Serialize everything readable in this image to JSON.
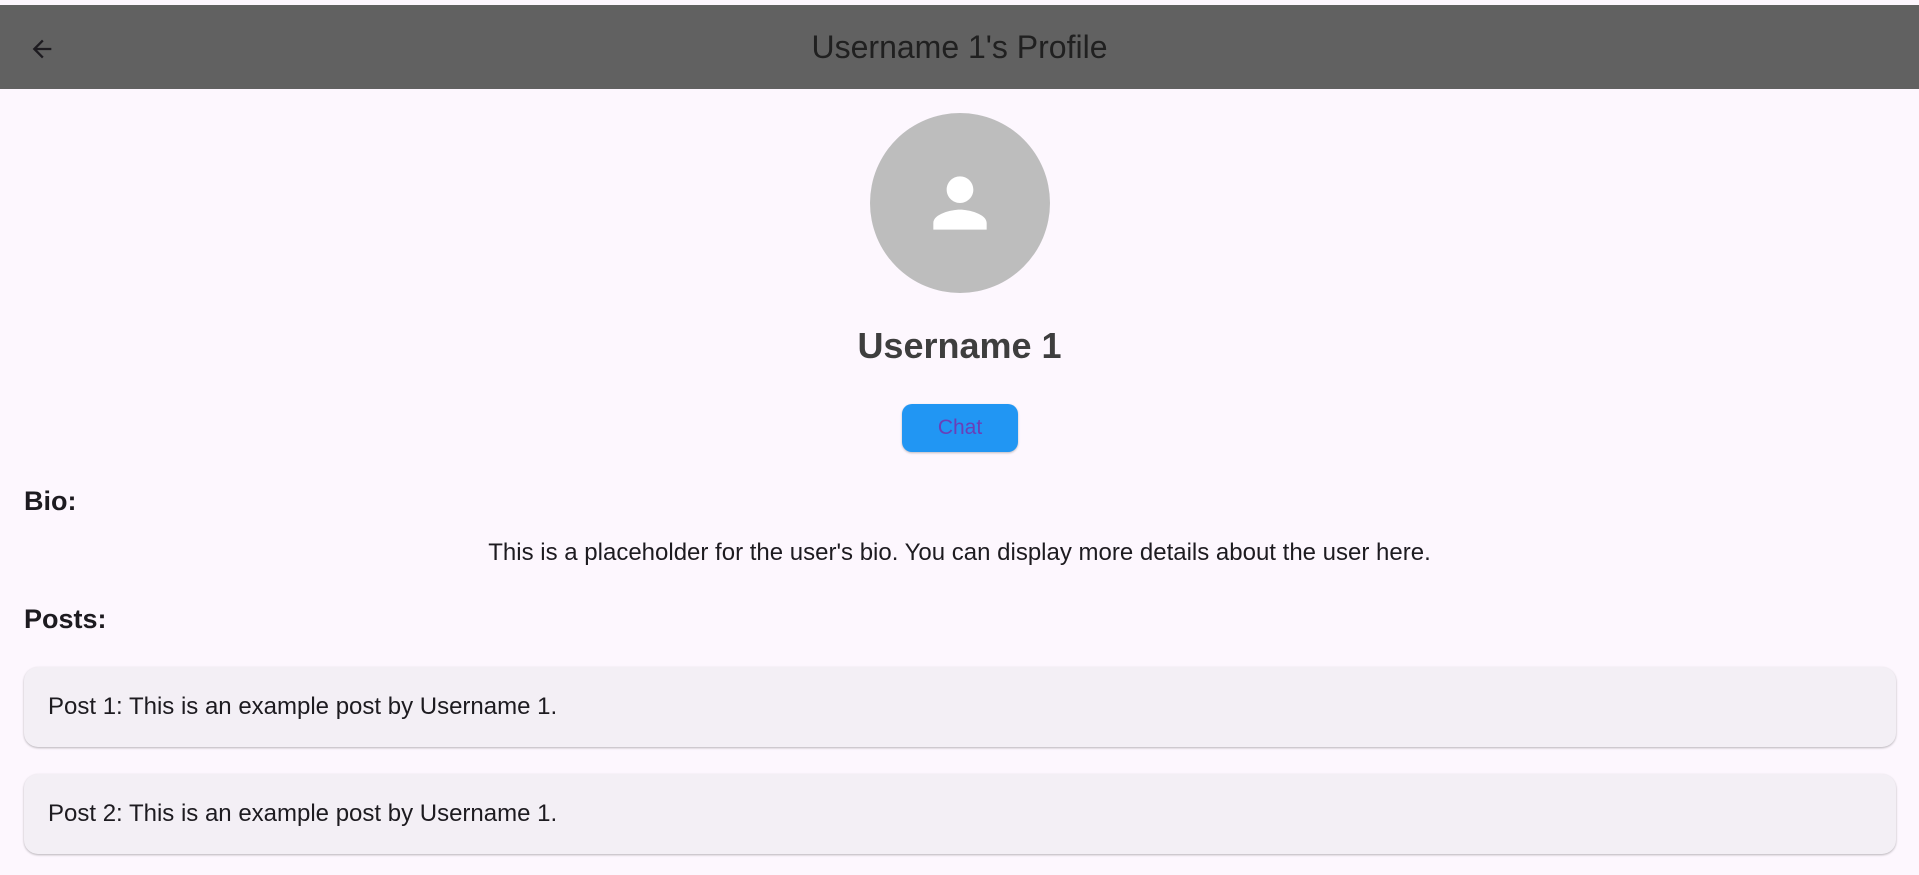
{
  "appbar": {
    "title": "Username 1's Profile",
    "background_color": "#616161",
    "back_icon": "arrow-back-icon"
  },
  "profile": {
    "avatar_icon": "person-icon",
    "avatar_color": "#bdbdbd",
    "username": "Username 1",
    "chat_button_label": "Chat",
    "chat_button_color": "#2196f3"
  },
  "bio": {
    "heading": "Bio:",
    "text": "This is a placeholder for the user's bio. You can display more details about the user here."
  },
  "posts": {
    "heading": "Posts:",
    "items": [
      {
        "text": "Post 1: This is an example post by Username 1."
      },
      {
        "text": "Post 2: This is an example post by Username 1."
      }
    ]
  }
}
